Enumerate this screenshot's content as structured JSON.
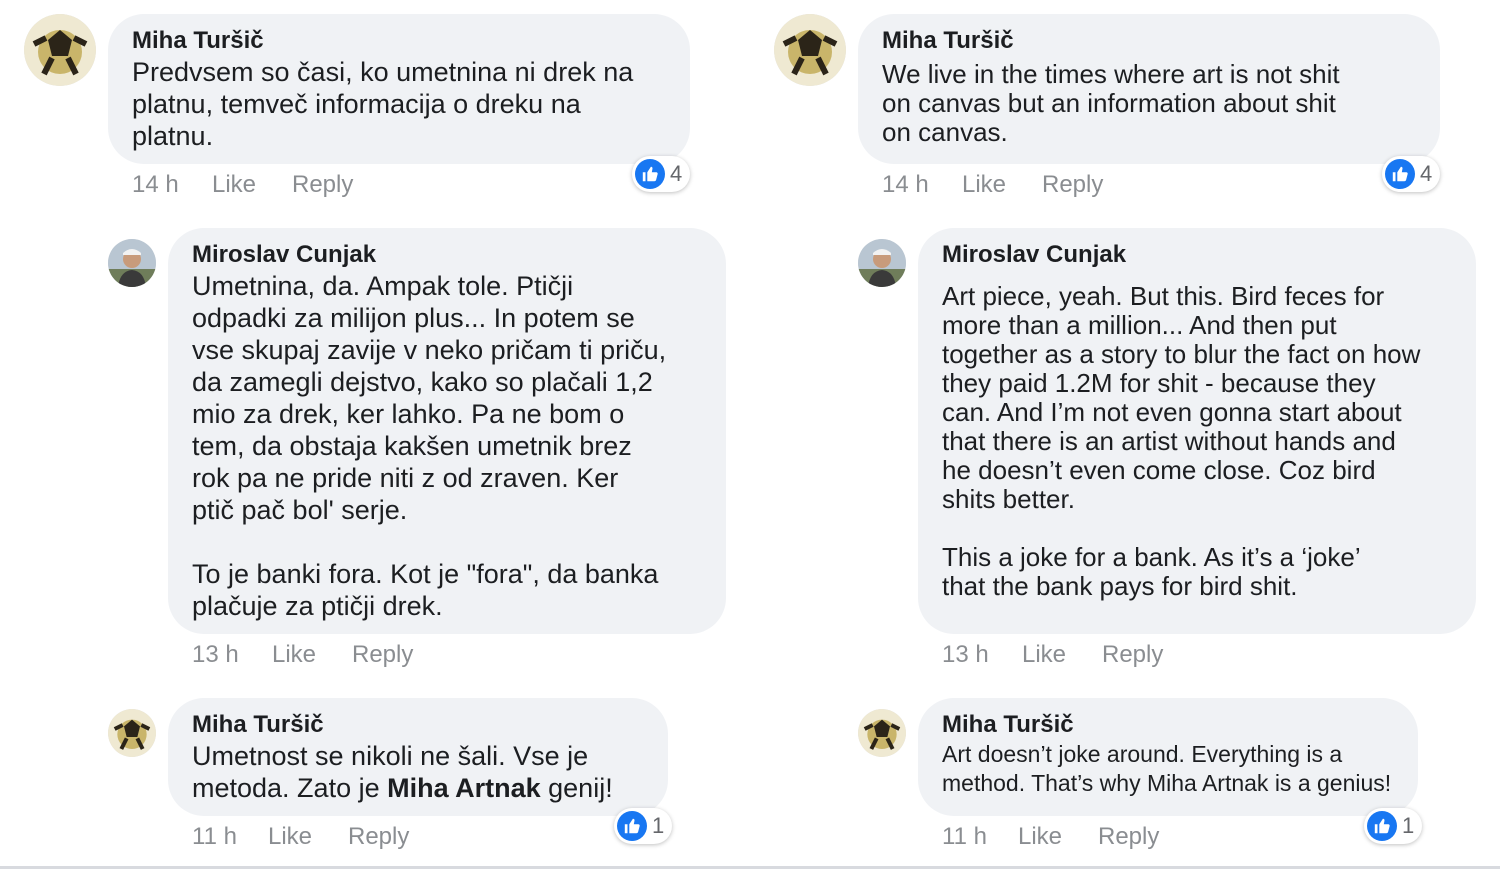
{
  "left": {
    "comments": [
      {
        "author": "Miha Turšič",
        "text": "Predvsem so časi, ko umetnina ni drek na\nplatnu, temveč informacija o dreku na\nplatnu.",
        "time": "14 h",
        "like": "Like",
        "reply": "Reply",
        "reactions": "4"
      },
      {
        "author": "Miroslav Cunjak",
        "text": "Umetnina, da. Ampak tole. Ptičji\nodpadki za milijon plus... In potem se\nvse skupaj zavije v neko pričam ti priču,\nda zamegli dejstvo, kako so plačali 1,2\nmio za drek, ker lahko. Pa ne bom o\ntem, da obstaja kakšen umetnik brez\nrok pa ne pride niti z od zraven. Ker\nptič pač bol' serje.\n\nTo je banki fora. Kot je \"fora\", da banka\nplačuje za ptičji drek.",
        "time": "13 h",
        "like": "Like",
        "reply": "Reply"
      },
      {
        "author": "Miha Turšič",
        "text_before": "Umetnost se nikoli ne šali. Vse je\nmetoda. Zato je ",
        "mention": "Miha Artnak",
        "text_after": " genij!",
        "time": "11 h",
        "like": "Like",
        "reply": "Reply",
        "reactions": "1"
      }
    ]
  },
  "right": {
    "comments": [
      {
        "author": "Miha Turšič",
        "text": "We live in the times where art is not shit\non canvas but an information about shit\non canvas.",
        "time": "14 h",
        "like": "Like",
        "reply": "Reply",
        "reactions": "4"
      },
      {
        "author": "Miroslav Cunjak",
        "text": "Art piece, yeah. But this. Bird feces for\nmore than a million... And then put\ntogether as a story to blur the fact on how\nthey paid 1.2M for shit - because they\ncan. And I’m not even gonna start about\nthat there is an artist without hands and\nhe doesn’t even come close. Coz bird\nshits better.\n\nThis a joke for a bank. As it’s a ‘joke’\nthat the bank pays for bird shit.",
        "time": "13 h",
        "like": "Like",
        "reply": "Reply"
      },
      {
        "author": "Miha Turšič",
        "text": "Art doesn’t joke around. Everything is a\nmethod. That’s why Miha Artnak is a genius!",
        "time": "11 h",
        "like": "Like",
        "reply": "Reply",
        "reactions": "1"
      }
    ]
  },
  "colors": {
    "bubble": "#f0f2f5",
    "like_blue": "#1877f2",
    "meta_gray": "#8a8d91"
  },
  "icons": {
    "avatar_miha": "soccer-ball-avatar",
    "avatar_miroslav": "person-photo-avatar",
    "reaction": "thumbs-up-icon"
  }
}
